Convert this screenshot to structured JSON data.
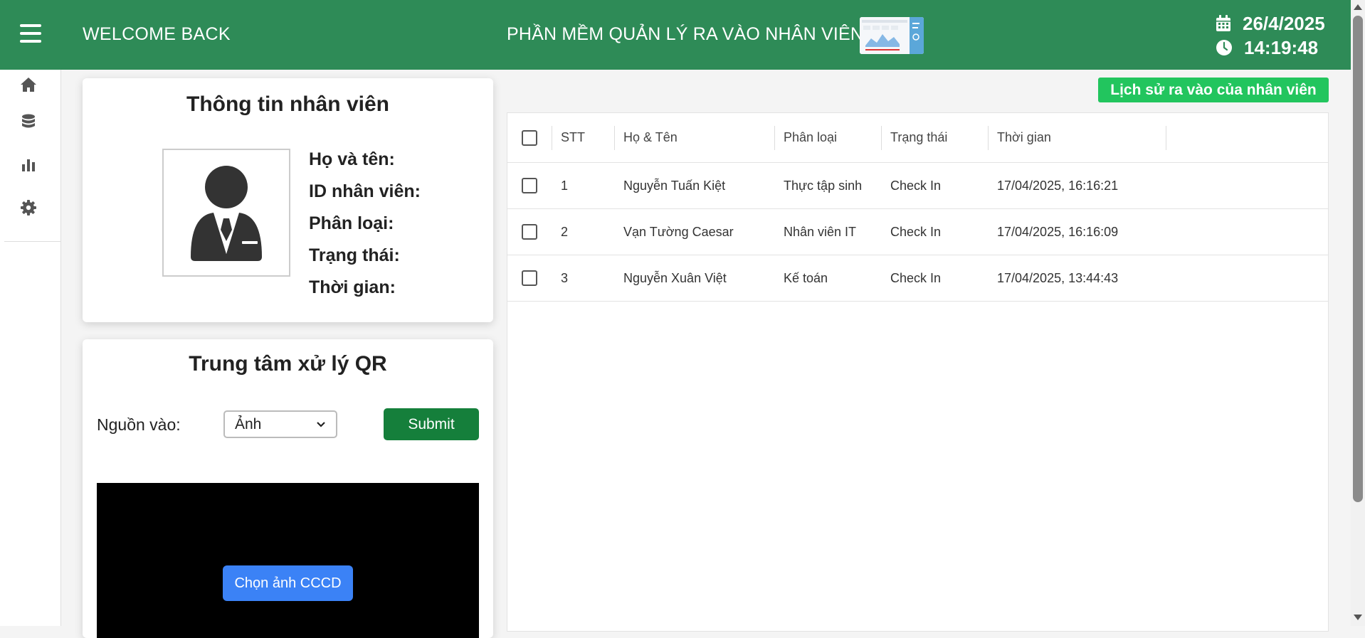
{
  "header": {
    "welcome": "WELCOME BACK",
    "title": "PHẦN MỀM QUẢN LÝ RA VÀO NHÂN VIÊN",
    "date": "26/4/2025",
    "time": "14:19:48",
    "bg_color": "#2e8b57"
  },
  "sidebar": {
    "items": [
      {
        "icon": "home-icon"
      },
      {
        "icon": "database-icon"
      },
      {
        "icon": "chart-icon"
      },
      {
        "icon": "gear-icon"
      }
    ]
  },
  "employee_info": {
    "title": "Thông tin nhân viên",
    "labels": {
      "name": "Họ và tên:",
      "id": "ID nhân viên:",
      "category": "Phân loại:",
      "status": "Trạng thái:",
      "time": "Thời gian:"
    }
  },
  "qr_center": {
    "title": "Trung tâm xử lý QR",
    "source_label": "Nguồn vào:",
    "source_value": "Ảnh",
    "submit_label": "Submit",
    "choose_label": "Chọn ảnh CCCD"
  },
  "history_button": "Lịch sử ra vào của nhân viên",
  "table": {
    "headers": [
      "STT",
      "Họ & Tên",
      "Phân loại",
      "Trạng thái",
      "Thời gian"
    ],
    "rows": [
      [
        "1",
        "Nguyễn Tuấn Kiệt",
        "Thực tập sinh",
        "Check In",
        "17/04/2025, 16:16:21"
      ],
      [
        "2",
        "Vạn Tường Caesar",
        "Nhân viên IT",
        "Check In",
        "17/04/2025, 16:16:09"
      ],
      [
        "3",
        "Nguyễn Xuân Việt",
        "Kế toán",
        "Check In",
        "17/04/2025, 13:44:43"
      ]
    ]
  },
  "colors": {
    "accent_green": "#22c55e",
    "submit_green": "#157f3b",
    "choose_blue": "#3b82f6"
  }
}
